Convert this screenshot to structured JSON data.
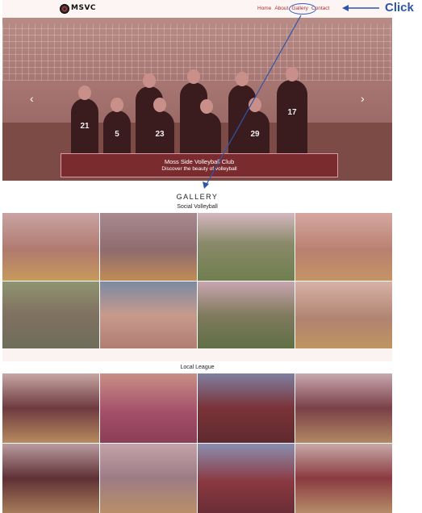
{
  "nav": {
    "logo_text": "MSVC",
    "links": [
      "Home",
      "About",
      "Gallery",
      "Contact"
    ]
  },
  "hero": {
    "jersey_numbers": [
      "21",
      "5",
      "23",
      "17",
      "29"
    ],
    "title": "Moss Side Volleyball Club",
    "subtitle": "Discover the beauty of volleyball",
    "prev_icon": "chevron-left-icon",
    "next_icon": "chevron-right-icon"
  },
  "gallery": {
    "title": "GALLERY",
    "sections": [
      {
        "label": "Social Volleyball"
      },
      {
        "label": "Local League"
      }
    ]
  },
  "annotation": {
    "label": "Click",
    "color": "#2e55a8"
  }
}
